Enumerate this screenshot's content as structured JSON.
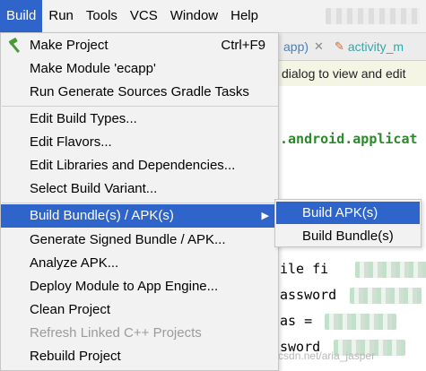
{
  "menubar": {
    "items": [
      "Build",
      "Run",
      "Tools",
      "VCS",
      "Window",
      "Help"
    ],
    "active_index": 0
  },
  "editor": {
    "tabs": [
      {
        "label": "app)",
        "close": "✕"
      },
      {
        "label": "activity_m",
        "icon": "layout-file-icon"
      }
    ],
    "hint": "dialog to view and edit",
    "code_lines": [
      ".android.applicat",
      "ile fi",
      "assword",
      "as =",
      "sword"
    ]
  },
  "build_menu": {
    "items": [
      {
        "label": "Make Project",
        "shortcut": "Ctrl+F9",
        "icon": "hammer-icon"
      },
      {
        "label": "Make Module 'ecapp'"
      },
      {
        "label": "Run Generate Sources Gradle Tasks"
      },
      {
        "label": "Edit Build Types..."
      },
      {
        "label": "Edit Flavors..."
      },
      {
        "label": "Edit Libraries and Dependencies..."
      },
      {
        "label": "Select Build Variant..."
      },
      {
        "label": "Build Bundle(s) / APK(s)",
        "submenu": true,
        "arrow": "▶"
      },
      {
        "label": "Generate Signed Bundle / APK..."
      },
      {
        "label": "Analyze APK..."
      },
      {
        "label": "Deploy Module to App Engine..."
      },
      {
        "label": "Clean Project"
      },
      {
        "label": "Refresh Linked C++ Projects",
        "disabled": true
      },
      {
        "label": "Rebuild Project"
      }
    ]
  },
  "submenu": {
    "items": [
      "Build APK(s)",
      "Build Bundle(s)"
    ]
  },
  "watermark": "https://blog.csdn.net/aria_jasper",
  "colors": {
    "highlight": "#2f65ca",
    "menu_bg": "#f2f2f2",
    "disabled": "#9b9b9b"
  }
}
